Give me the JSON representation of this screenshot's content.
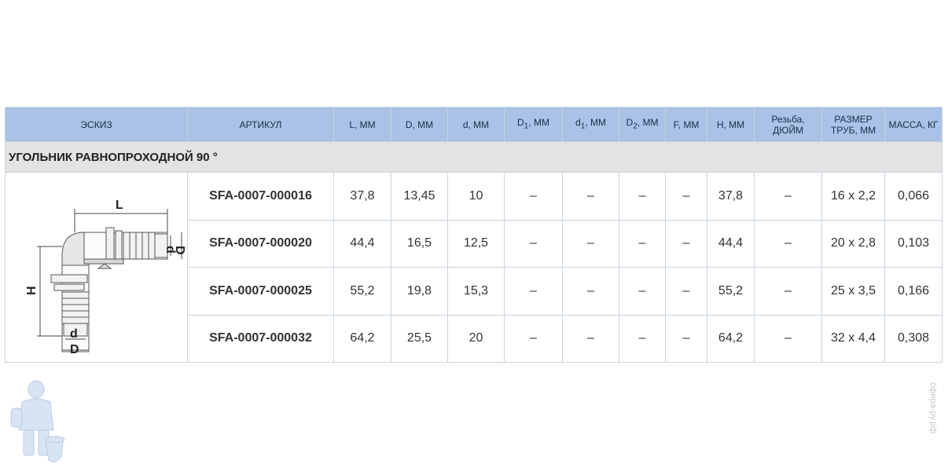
{
  "headers": {
    "sketch": "ЭСКИЗ",
    "article": "АРТИКУЛ",
    "L": "L, ММ",
    "D": "D, ММ",
    "d": "d, ММ",
    "D1_main": "D",
    "D1_sub": "1",
    "d1_main": "d",
    "d1_sub": "1",
    "D2_main": "D",
    "D2_sub": "2",
    "unit_mm": ", ММ",
    "F": "F, ММ",
    "H": "H, ММ",
    "thread_line1": "Резьба,",
    "thread_line2": "ДЮЙМ",
    "pipe_line1": "РАЗМЕР",
    "pipe_line2": "ТРУБ, ММ",
    "mass": "МАССА, КГ"
  },
  "section_title": "УГОЛЬНИК РАВНОПРОХОДНОЙ 90 °",
  "sketch_labels": {
    "L": "L",
    "H": "H",
    "d": "d",
    "D": "D"
  },
  "rows": [
    {
      "article": "SFA-0007-000016",
      "L": "37,8",
      "D": "13,45",
      "d": "10",
      "D1": "–",
      "d1": "–",
      "D2": "–",
      "F": "–",
      "H": "37,8",
      "thread": "–",
      "pipe": "16 x 2,2",
      "mass": "0,066"
    },
    {
      "article": "SFA-0007-000020",
      "L": "44,4",
      "D": "16,5",
      "d": "12,5",
      "D1": "–",
      "d1": "–",
      "D2": "–",
      "F": "–",
      "H": "44,4",
      "thread": "–",
      "pipe": "20 x 2,8",
      "mass": "0,103"
    },
    {
      "article": "SFA-0007-000025",
      "L": "55,2",
      "D": "19,8",
      "d": "15,3",
      "D1": "–",
      "d1": "–",
      "D2": "–",
      "F": "–",
      "H": "55,2",
      "thread": "–",
      "pipe": "25 x 3,5",
      "mass": "0,166"
    },
    {
      "article": "SFA-0007-000032",
      "L": "64,2",
      "D": "25,5",
      "d": "20",
      "D1": "–",
      "d1": "–",
      "D2": "–",
      "F": "–",
      "H": "64,2",
      "thread": "–",
      "pipe": "32 x 4,4",
      "mass": "0,308"
    }
  ],
  "watermark": "сфера-ру.рф",
  "colors": {
    "header_bg": "#a9c2e6",
    "section_bg": "#e3e3e3",
    "border": "#c9d3e0"
  }
}
